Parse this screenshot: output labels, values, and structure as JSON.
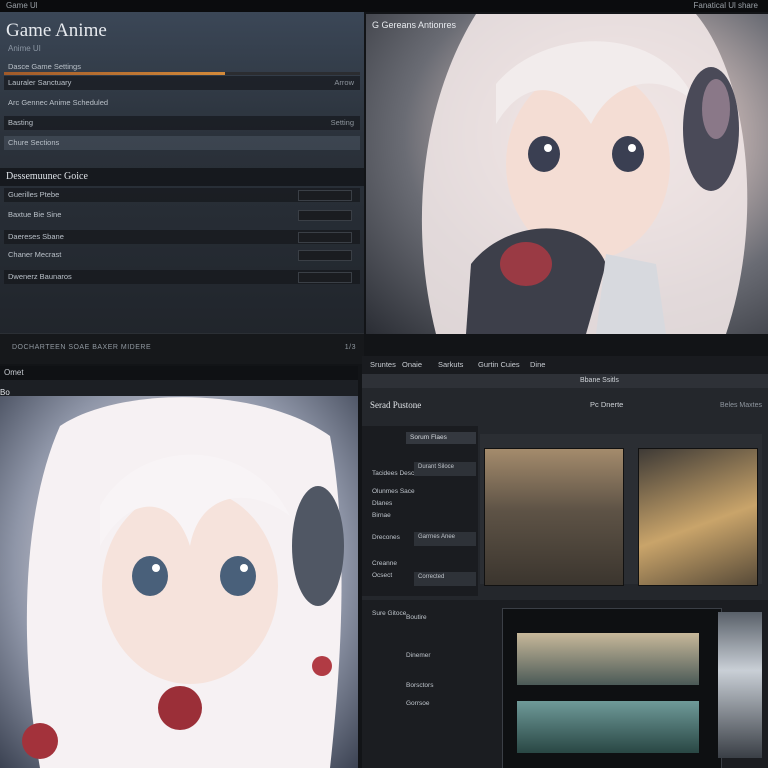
{
  "window": {
    "title_left": "Game Ul",
    "title_right": "Fanatical Ul share"
  },
  "settings": {
    "title": "Game Anime",
    "subtitle": "Anime UI",
    "rows": [
      {
        "label": "Dasce Game Settings",
        "value": ""
      },
      {
        "label": "Lauraler Sanctuary",
        "value": "Arrow"
      },
      {
        "label": "Arc Gennec Anime Scheduled",
        "value": ""
      },
      {
        "label": "Basting",
        "value": "Setting"
      },
      {
        "label": "Chure Sections",
        "value": ""
      }
    ],
    "section_title": "Dessemuunec Goice",
    "section_rows": [
      {
        "label": "Guerilles Ptebe",
        "value": ""
      },
      {
        "label": "Baxtue Bie Sine",
        "value": ""
      },
      {
        "label": "Daereses Sbane",
        "value": ""
      },
      {
        "label": "Chaner Mecrast",
        "value": ""
      },
      {
        "label": "Dwenerz Baunaros",
        "value": ""
      }
    ],
    "footer_text": "DOCHARTEEN SOAE BAXER MIDERE",
    "footer_page": "1/3"
  },
  "artwork_top": {
    "badge": "G  Gereans Antionres"
  },
  "character_card": {
    "header": "Omet",
    "tag": "Bo"
  },
  "store": {
    "nav": [
      "Sruntes",
      "Onaie",
      "Sarkuts",
      "Gurtin Cuies",
      "Dine"
    ],
    "subbar": "Bbane Ssitls",
    "section_left": "Serad Pustone",
    "section_right": "Pc Dnerte",
    "section_far": "Beles Maxtes",
    "menu_pill": "Sorum Flaes",
    "menu_items": [
      "Tacidees Desclite",
      "Olunmes Sace",
      "Dlanes",
      "Birnae",
      "Drecones",
      "Creanne",
      "Ocsect"
    ],
    "menu_boxes": [
      "Durant Siloce",
      "Garrnes Anee",
      "Corrected"
    ],
    "lower_items": [
      "Sure Gitoce",
      "Boutire",
      "Dinemer",
      "Borsctors",
      "Gorrsoe"
    ]
  }
}
